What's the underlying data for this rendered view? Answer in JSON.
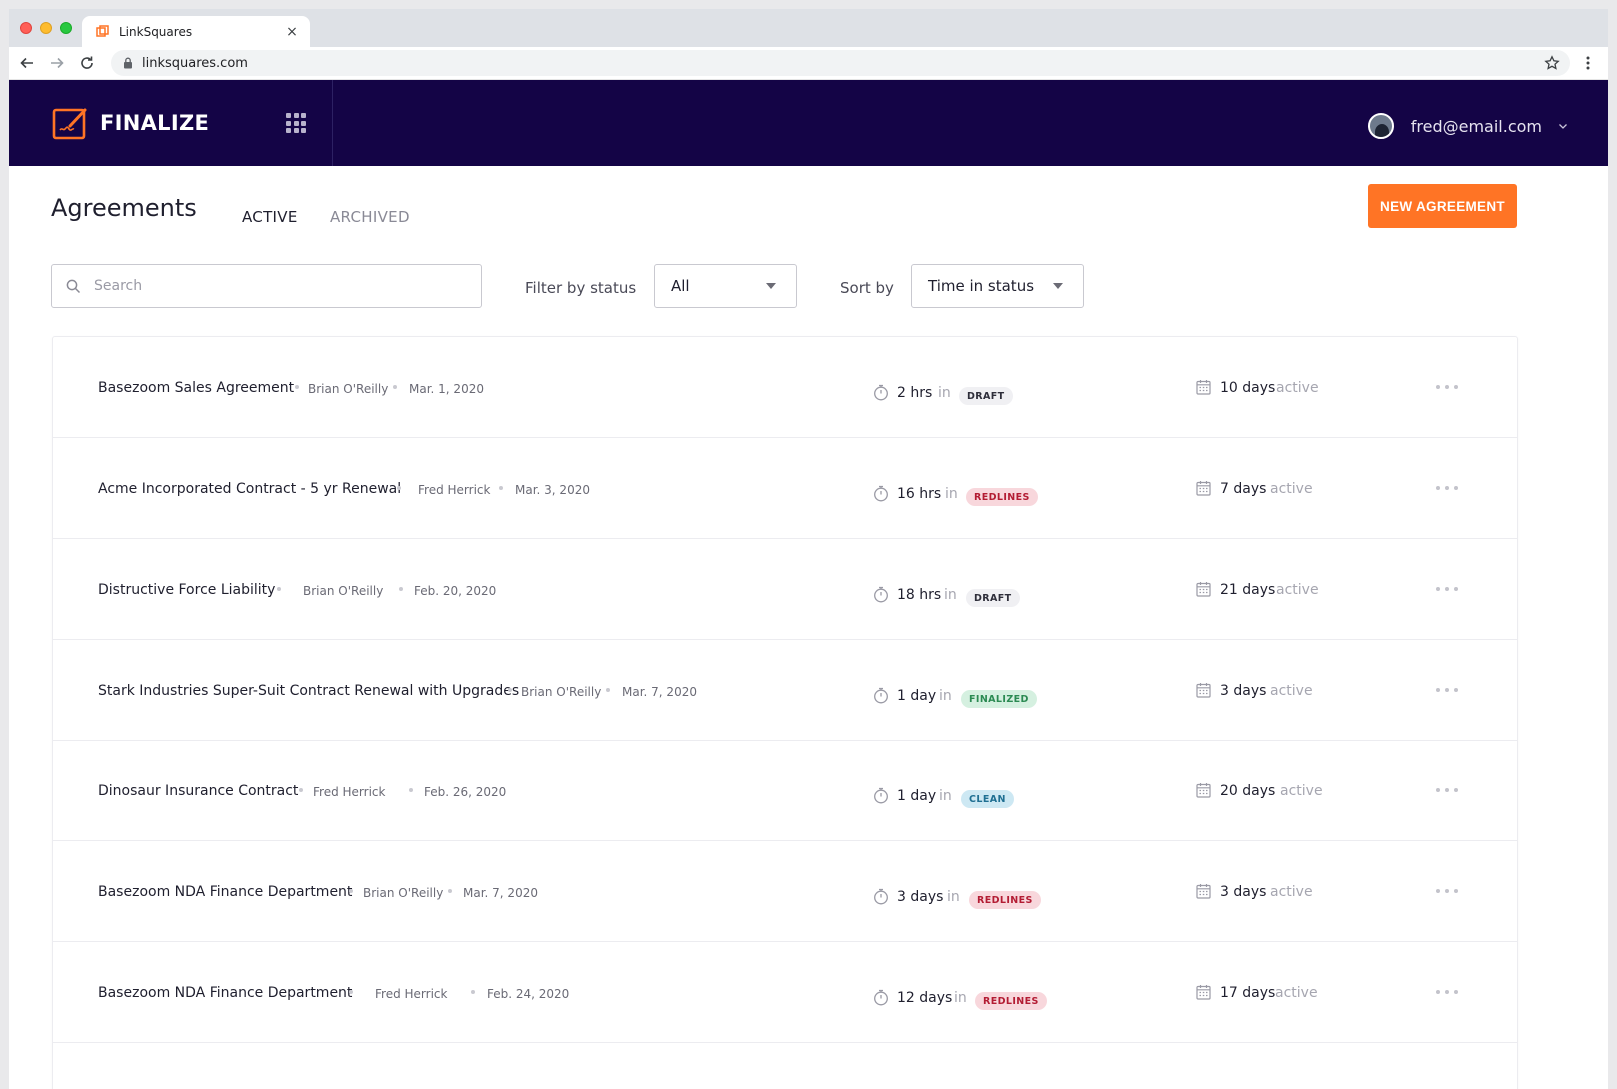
{
  "browser": {
    "tab_title": "LinkSquares",
    "tab_close": "×",
    "url": "linksquares.com"
  },
  "header": {
    "brand": "FINALIZE",
    "user_email": "fred@email.com"
  },
  "page": {
    "title": "Agreements",
    "tabs": [
      {
        "label": "ACTIVE",
        "selected": true
      },
      {
        "label": "ARCHIVED",
        "selected": false
      }
    ],
    "new_button": "NEW AGREEMENT"
  },
  "filters": {
    "search_placeholder": "Search",
    "status_label": "Filter by status",
    "status_value": "All",
    "sort_label": "Sort by",
    "sort_value": "Time in status"
  },
  "agreements": [
    {
      "name": "Basezoom Sales Agreement",
      "owner": "Brian O'Reilly",
      "date": "Mar. 1, 2020",
      "time": "2 hrs",
      "in": "in",
      "status": "DRAFT",
      "status_kind": "draft",
      "days": "10 days",
      "active": "active"
    },
    {
      "name": "Acme Incorporated Contract - 5 yr Renewal",
      "owner": "Fred Herrick",
      "date": "Mar. 3, 2020",
      "time": "16 hrs",
      "in": "in",
      "status": "REDLINES",
      "status_kind": "redlines",
      "days": "7 days",
      "active": "active"
    },
    {
      "name": "Distructive Force Liability",
      "owner": "Brian O'Reilly",
      "date": "Feb. 20, 2020",
      "time": "18 hrs",
      "in": "in",
      "status": "DRAFT",
      "status_kind": "draft",
      "days": "21 days",
      "active": "active"
    },
    {
      "name": "Stark Industries Super-Suit Contract Renewal with Upgrades",
      "owner": "Brian O'Reilly",
      "date": "Mar. 7, 2020",
      "time": "1 day",
      "in": "in",
      "status": "FINALIZED",
      "status_kind": "finalized",
      "days": "3 days",
      "active": "active"
    },
    {
      "name": "Dinosaur Insurance Contract",
      "owner": "Fred Herrick",
      "date": "Feb. 26, 2020",
      "time": "1 day",
      "in": "in",
      "status": "CLEAN",
      "status_kind": "clean",
      "days": "20 days",
      "active": "active"
    },
    {
      "name": "Basezoom NDA Finance Department",
      "owner": "Brian O'Reilly",
      "date": "Mar. 7, 2020",
      "time": "3 days",
      "in": "in",
      "status": "REDLINES",
      "status_kind": "redlines",
      "days": "3 days",
      "active": "active"
    },
    {
      "name": "Basezoom NDA Finance Department",
      "owner": "Fred Herrick",
      "date": "Feb. 24, 2020",
      "time": "12 days",
      "in": "in",
      "status": "REDLINES",
      "status_kind": "redlines",
      "days": "17 days",
      "active": "active"
    }
  ]
}
